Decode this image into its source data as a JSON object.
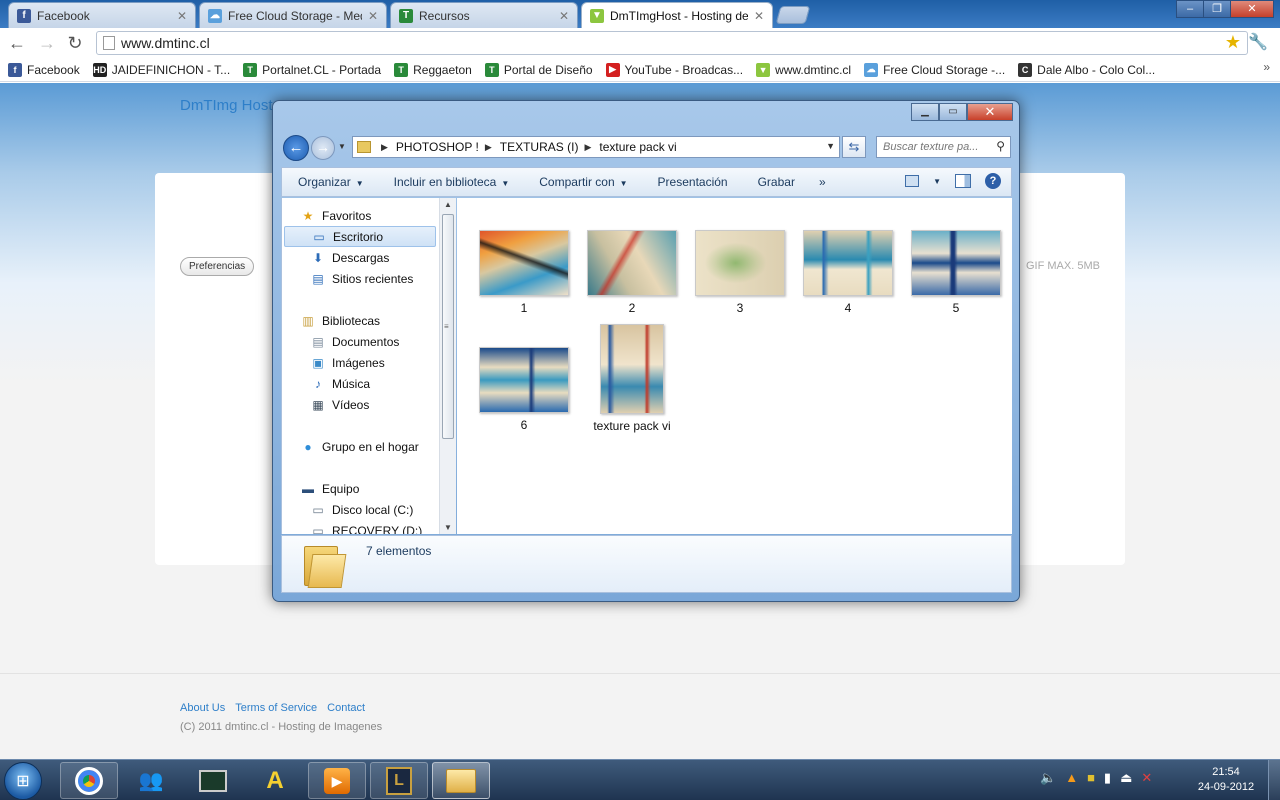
{
  "browser": {
    "tabs": [
      {
        "label": "Facebook",
        "icon": "f",
        "color": "#3b5998"
      },
      {
        "label": "Free Cloud Storage - Media",
        "icon": "☁",
        "color": "#5aa0dc"
      },
      {
        "label": "Recursos",
        "icon": "T",
        "color": "#2a8a3a"
      },
      {
        "label": "DmTImgHost - Hosting de",
        "icon": "▼",
        "color": "#8cc63f"
      }
    ],
    "url": "www.dmtinc.cl",
    "bookmarks": [
      {
        "label": "Facebook",
        "icon": "f",
        "color": "#3b5998"
      },
      {
        "label": "JAIDEFINICHON - T...",
        "icon": "HD",
        "color": "#222"
      },
      {
        "label": "Portalnet.CL - Portada",
        "icon": "T",
        "color": "#2a8a3a"
      },
      {
        "label": "Reggaeton",
        "icon": "T",
        "color": "#2a8a3a"
      },
      {
        "label": "Portal de Diseño",
        "icon": "T",
        "color": "#2a8a3a"
      },
      {
        "label": "YouTube - Broadcas...",
        "icon": "▶",
        "color": "#d42020"
      },
      {
        "label": "www.dmtinc.cl",
        "icon": "▼",
        "color": "#8cc63f"
      },
      {
        "label": "Free Cloud Storage -...",
        "icon": "☁",
        "color": "#5aa0dc"
      },
      {
        "label": "Dale Albo - Colo Col...",
        "icon": "C",
        "color": "#333"
      }
    ],
    "more": "»"
  },
  "site": {
    "title": "DmTImg Host",
    "preferences": "Preferencias",
    "limits": "GIF   MAX. 5MB",
    "footer_links": [
      "About Us",
      "Terms of Service",
      "Contact"
    ],
    "copyright": "(C) 2011 dmtinc.cl - Hosting de Imagenes"
  },
  "explorer": {
    "path": [
      "PHOTOSHOP !",
      "TEXTURAS (I)",
      "texture pack vi"
    ],
    "search_placeholder": "Buscar texture pa...",
    "commands": [
      "Organizar",
      "Incluir en biblioteca",
      "Compartir con",
      "Presentación",
      "Grabar"
    ],
    "more": "»",
    "nav": [
      {
        "label": "Favoritos",
        "icon": "★",
        "level": 0
      },
      {
        "label": "Escritorio",
        "icon": "▭",
        "level": 1,
        "selected": true
      },
      {
        "label": "Descargas",
        "icon": "⬇",
        "level": 1
      },
      {
        "label": "Sitios recientes",
        "icon": "▤",
        "level": 1
      },
      {
        "label": "Bibliotecas",
        "icon": "▥",
        "level": 0
      },
      {
        "label": "Documentos",
        "icon": "▤",
        "level": 1
      },
      {
        "label": "Imágenes",
        "icon": "▣",
        "level": 1
      },
      {
        "label": "Música",
        "icon": "♪",
        "level": 1
      },
      {
        "label": "Vídeos",
        "icon": "▦",
        "level": 1
      },
      {
        "label": "Grupo en el hogar",
        "icon": "●",
        "level": 0
      },
      {
        "label": "Equipo",
        "icon": "▬",
        "level": 0
      },
      {
        "label": "Disco local (C:)",
        "icon": "▭",
        "level": 1
      },
      {
        "label": "RECOVERY (D:)",
        "icon": "▭",
        "level": 1
      }
    ],
    "files": [
      {
        "name": "1"
      },
      {
        "name": "2"
      },
      {
        "name": "3"
      },
      {
        "name": "4"
      },
      {
        "name": "5"
      },
      {
        "name": "6"
      },
      {
        "name": "texture pack vi"
      }
    ],
    "status": "7 elementos"
  },
  "taskbar": {
    "clock_time": "21:54",
    "clock_date": "24-09-2012"
  }
}
